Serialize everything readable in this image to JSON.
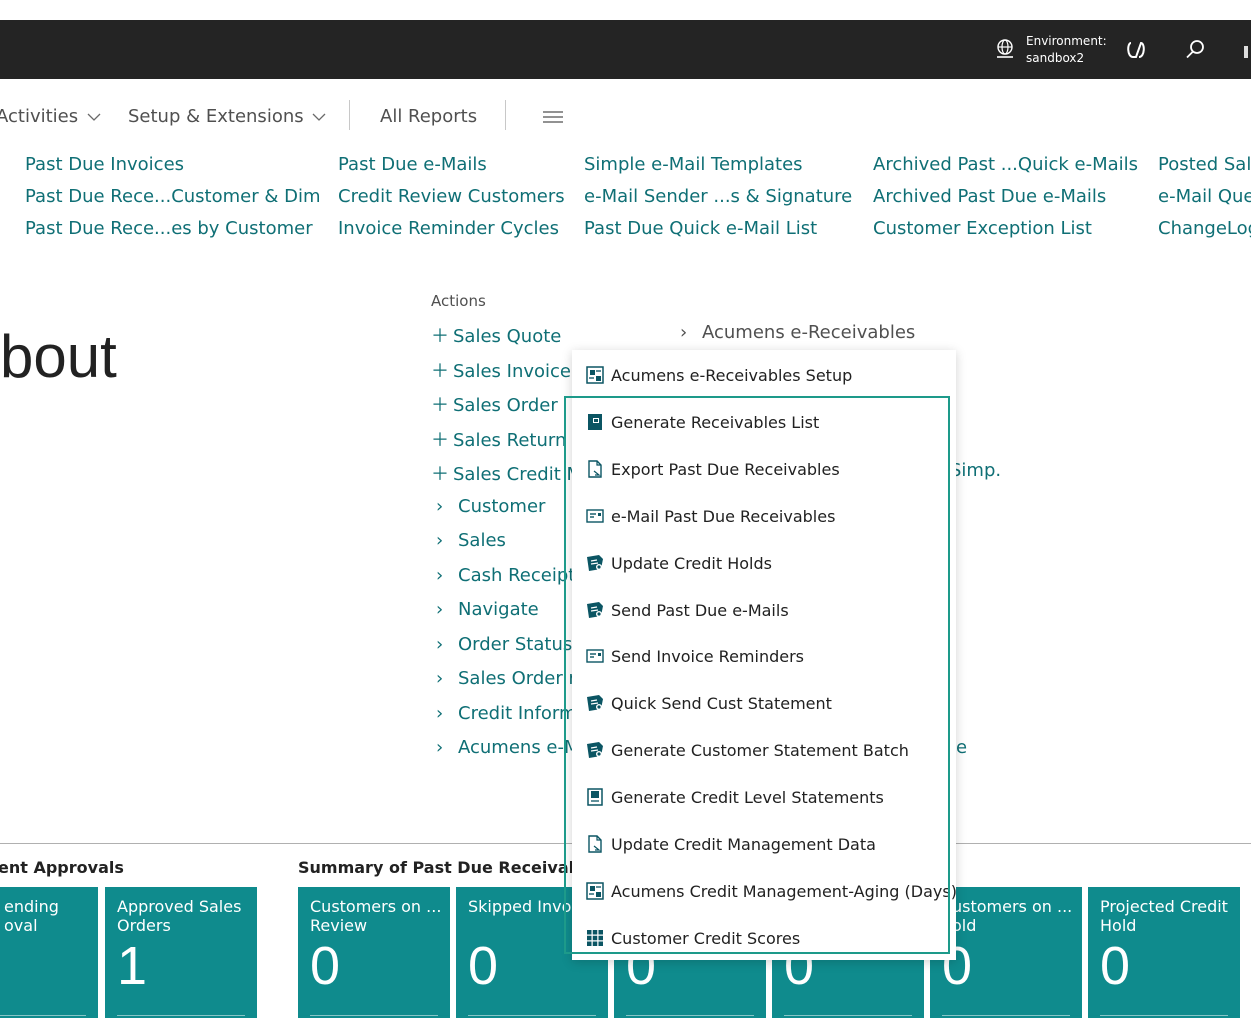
{
  "topbar": {
    "env_label": "Environment:",
    "env_value": "sandbox2"
  },
  "nav": {
    "activities": "Activities",
    "setup": "Setup & Extensions",
    "all_reports": "All Reports"
  },
  "links": {
    "col1": [
      "Past Due Invoices",
      "Past Due Rece...Customer & Dim",
      "Past Due Rece...es by Customer"
    ],
    "col2": [
      "Past Due e-Mails",
      "Credit Review Customers",
      "Invoice Reminder Cycles"
    ],
    "col3": [
      "Simple e-Mail Templates",
      "e-Mail Sender ...s & Signature",
      "Past Due Quick e-Mail List"
    ],
    "col4": [
      "Archived Past ...Quick e-Mails",
      "Archived Past Due e-Mails",
      "Customer Exception List"
    ],
    "col5": [
      "Posted Sal",
      "e-Mail Que",
      "ChangeLog"
    ]
  },
  "page_title": "bout",
  "actions": {
    "label": "Actions",
    "items": [
      "Sales Quote",
      "Sales Invoice",
      "Sales Order",
      "Sales Return (",
      "Sales Credit M",
      "Customer",
      "Sales",
      "Cash Receipt",
      "Navigate",
      "Order Status",
      "Sales Order r",
      "Credit Inform",
      "Acumens e-M"
    ],
    "group_header": "Acumens e-Receivables",
    "partial_right_1": "Simp.",
    "partial_right_2": "e"
  },
  "dropdown": {
    "items": [
      {
        "label": "Acumens e-Receivables Setup",
        "icon": "setup-icon"
      },
      {
        "label": "Generate Receivables List",
        "icon": "generate-list-icon"
      },
      {
        "label": "Export Past Due Receivables",
        "icon": "export-document-icon"
      },
      {
        "label": "e-Mail Past Due Receivables",
        "icon": "email-card-icon"
      },
      {
        "label": "Update Credit Holds",
        "icon": "process-icon"
      },
      {
        "label": "Send Past Due e-Mails",
        "icon": "process-icon"
      },
      {
        "label": "Send Invoice Reminders",
        "icon": "email-card-icon"
      },
      {
        "label": "Quick Send Cust Statement",
        "icon": "process-icon"
      },
      {
        "label": "Generate Customer Statement Batch",
        "icon": "process-icon"
      },
      {
        "label": "Generate Credit Level Statements",
        "icon": "statement-icon"
      },
      {
        "label": "Update Credit Management Data",
        "icon": "document-icon"
      },
      {
        "label": "Acumens Credit Management-Aging (Days)",
        "icon": "setup-icon"
      },
      {
        "label": "Customer Credit Scores",
        "icon": "grid-icon"
      }
    ]
  },
  "bottom": {
    "section1_title": "ent Approvals",
    "section2_title": "Summary of Past Due Receivables",
    "tiles": [
      {
        "label": "ending\noval",
        "value": ""
      },
      {
        "label": "Approved Sales Orders",
        "value": "1"
      },
      {
        "label": "Customers on ... Review",
        "value": "0"
      },
      {
        "label": "Skipped Invoices",
        "value": "0"
      },
      {
        "label": "",
        "value": "0"
      },
      {
        "label": "",
        "value": "0"
      },
      {
        "label": "ustomers on ...\nold",
        "value": "0"
      },
      {
        "label": "Projected Credit Hold",
        "value": "0"
      }
    ]
  },
  "colors": {
    "accent": "#0f6f75",
    "tile": "#0f8b8d",
    "topbar": "#242424",
    "highlight": "#1d9a8a"
  }
}
